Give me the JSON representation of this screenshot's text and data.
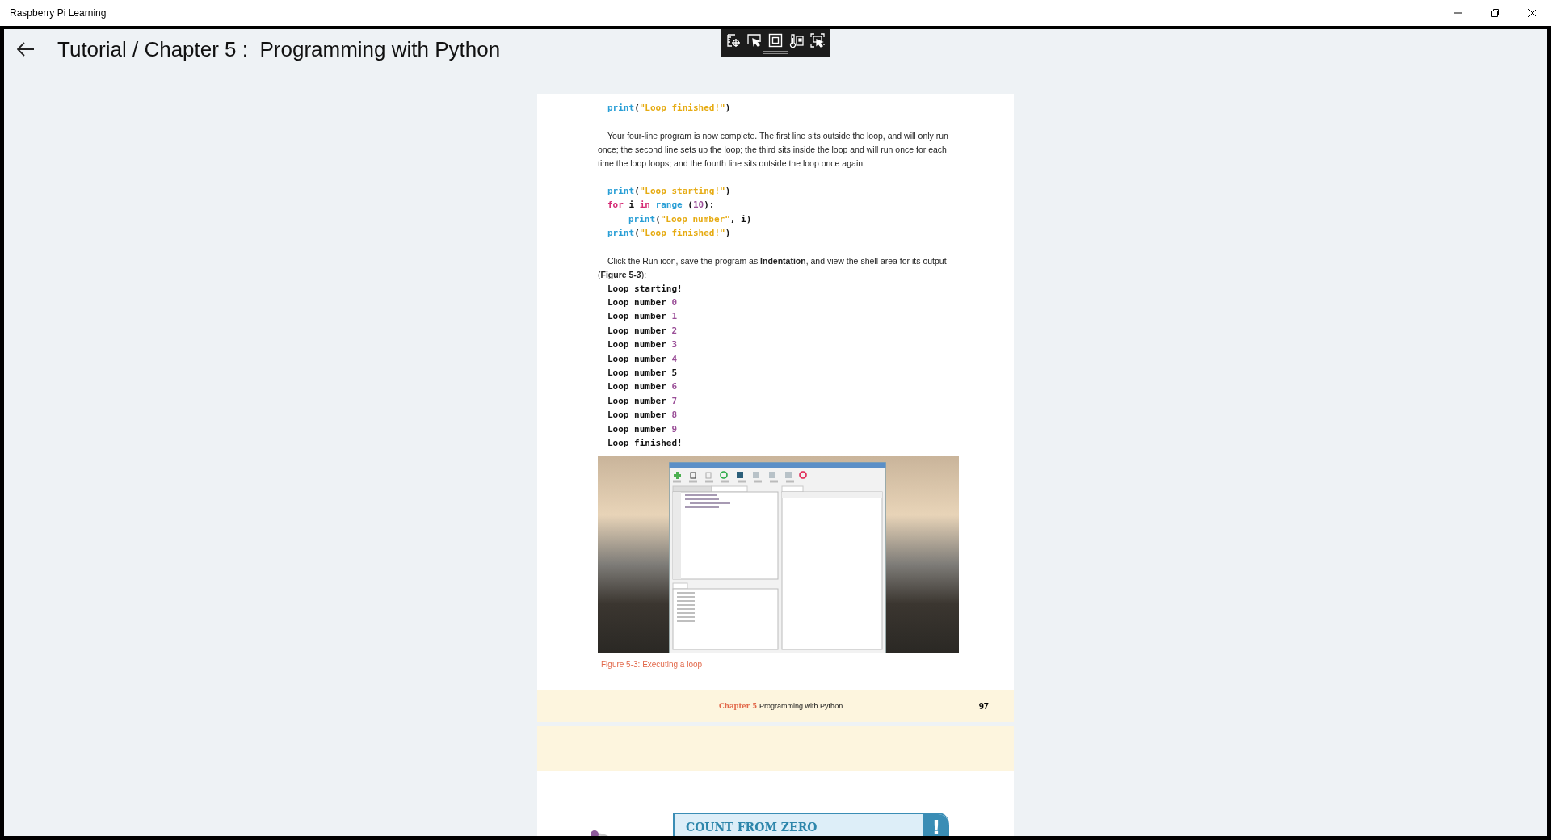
{
  "window": {
    "title": "Raspberry Pi Learning"
  },
  "header": {
    "title": "Tutorial / Chapter 5 :  Programming with Python"
  },
  "page": {
    "code_top": [
      [
        {
          "text": "print",
          "kind": "builtin"
        },
        {
          "text": "(",
          "kind": "plain"
        },
        {
          "text": "\"Loop finished!\"",
          "kind": "string"
        },
        {
          "text": ")",
          "kind": "plain"
        }
      ]
    ],
    "paragraph_1": "Your four-line program is now complete. The first line sits outside the loop, and will only run once; the second line sets up the loop; the third sits inside the loop and will run once for each time the loop loops; and the fourth line sits outside the loop once again.",
    "code": [
      {
        "indent": false,
        "tokens": [
          {
            "text": "print",
            "kind": "builtin"
          },
          {
            "text": "(",
            "kind": "plain"
          },
          {
            "text": "\"Loop starting!\"",
            "kind": "string"
          },
          {
            "text": ")",
            "kind": "plain"
          }
        ]
      },
      {
        "indent": false,
        "tokens": [
          {
            "text": "for",
            "kind": "keyword"
          },
          {
            "text": " i ",
            "kind": "plain"
          },
          {
            "text": "in",
            "kind": "keyword"
          },
          {
            "text": " range",
            "kind": "builtin"
          },
          {
            "text": " (",
            "kind": "plain"
          },
          {
            "text": "10",
            "kind": "number"
          },
          {
            "text": "):",
            "kind": "plain"
          }
        ]
      },
      {
        "indent": true,
        "tokens": [
          {
            "text": "print",
            "kind": "builtin"
          },
          {
            "text": "(",
            "kind": "plain"
          },
          {
            "text": "\"Loop number\"",
            "kind": "string"
          },
          {
            "text": ", i)",
            "kind": "plain"
          }
        ]
      },
      {
        "indent": false,
        "tokens": [
          {
            "text": "print",
            "kind": "builtin"
          },
          {
            "text": "(",
            "kind": "plain"
          },
          {
            "text": "\"Loop finished!\"",
            "kind": "string"
          },
          {
            "text": ")",
            "kind": "plain"
          }
        ]
      }
    ],
    "paragraph_2": "Click the Run icon, save the program as **Indentation**, and view the shell area for its output (**Figure 5-3**):",
    "output": [
      [
        {
          "text": "Loop starting!",
          "kind": "plain"
        }
      ],
      [
        {
          "text": "Loop number ",
          "kind": "plain"
        },
        {
          "text": "0",
          "kind": "number"
        }
      ],
      [
        {
          "text": "Loop number ",
          "kind": "plain"
        },
        {
          "text": "1",
          "kind": "number"
        }
      ],
      [
        {
          "text": "Loop number ",
          "kind": "plain"
        },
        {
          "text": "2",
          "kind": "number"
        }
      ],
      [
        {
          "text": "Loop number ",
          "kind": "plain"
        },
        {
          "text": "3",
          "kind": "number"
        }
      ],
      [
        {
          "text": "Loop number ",
          "kind": "plain"
        },
        {
          "text": "4",
          "kind": "number"
        }
      ],
      [
        {
          "text": "Loop number 5",
          "kind": "plain"
        }
      ],
      [
        {
          "text": "Loop number ",
          "kind": "plain"
        },
        {
          "text": "6",
          "kind": "number"
        }
      ],
      [
        {
          "text": "Loop number ",
          "kind": "plain"
        },
        {
          "text": "7",
          "kind": "number"
        }
      ],
      [
        {
          "text": "Loop number ",
          "kind": "plain"
        },
        {
          "text": "8",
          "kind": "number"
        }
      ],
      [
        {
          "text": "Loop number ",
          "kind": "plain"
        },
        {
          "text": "9",
          "kind": "number"
        }
      ],
      [
        {
          "text": "Loop finished!",
          "kind": "plain"
        }
      ]
    ],
    "figure": {
      "caption": "Figure 5-3: Executing a loop"
    },
    "footer": {
      "chapter": "Chapter 5",
      "title": "Programming with Python",
      "page_number": "97"
    },
    "callout": {
      "title": "COUNT FROM ZERO",
      "mark": "!"
    }
  }
}
